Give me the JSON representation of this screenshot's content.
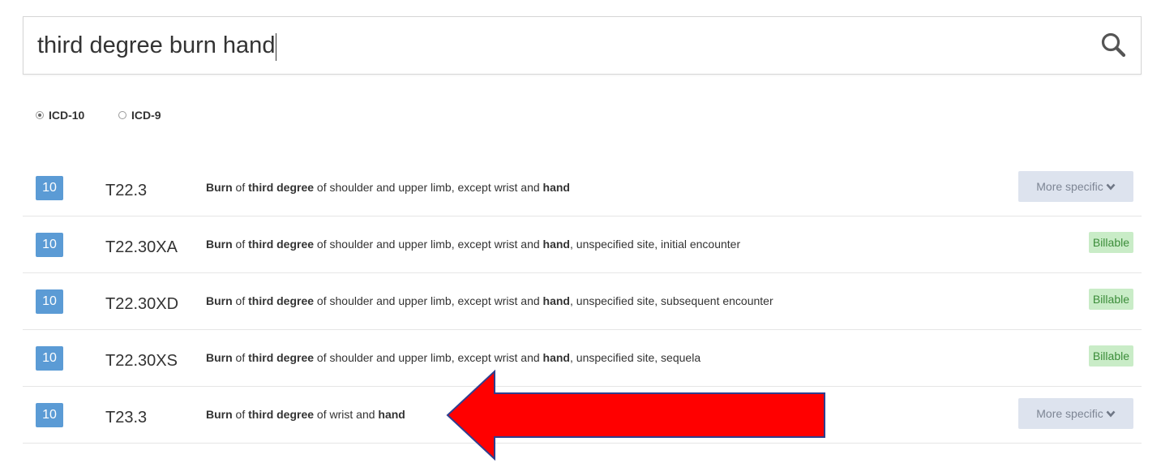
{
  "search": {
    "value": "third degree burn hand",
    "placeholder": "",
    "button_icon": "search-icon"
  },
  "code_system": {
    "selected": "ICD-10",
    "options": [
      {
        "label": "ICD-10",
        "checked": true
      },
      {
        "label": "ICD-9",
        "checked": false
      }
    ]
  },
  "results": [
    {
      "version": "10",
      "code": "T22.3",
      "description": [
        {
          "text": "Burn",
          "bold": true
        },
        {
          "text": " of ",
          "bold": false
        },
        {
          "text": "third degree",
          "bold": true
        },
        {
          "text": " of shoulder and upper limb, except wrist and ",
          "bold": false
        },
        {
          "text": "hand",
          "bold": true
        }
      ],
      "action": {
        "type": "more",
        "label": "More specific",
        "icon": "chevron-down-icon"
      }
    },
    {
      "version": "10",
      "code": "T22.30XA",
      "description": [
        {
          "text": "Burn",
          "bold": true
        },
        {
          "text": " of ",
          "bold": false
        },
        {
          "text": "third degree",
          "bold": true
        },
        {
          "text": " of shoulder and upper limb, except wrist and ",
          "bold": false
        },
        {
          "text": "hand",
          "bold": true
        },
        {
          "text": ", unspecified site, initial encounter",
          "bold": false
        }
      ],
      "action": {
        "type": "billable",
        "label": "Billable"
      }
    },
    {
      "version": "10",
      "code": "T22.30XD",
      "description": [
        {
          "text": "Burn",
          "bold": true
        },
        {
          "text": " of ",
          "bold": false
        },
        {
          "text": "third degree",
          "bold": true
        },
        {
          "text": " of shoulder and upper limb, except wrist and ",
          "bold": false
        },
        {
          "text": "hand",
          "bold": true
        },
        {
          "text": ", unspecified site, subsequent encounter",
          "bold": false
        }
      ],
      "action": {
        "type": "billable",
        "label": "Billable"
      }
    },
    {
      "version": "10",
      "code": "T22.30XS",
      "description": [
        {
          "text": "Burn",
          "bold": true
        },
        {
          "text": " of ",
          "bold": false
        },
        {
          "text": "third degree",
          "bold": true
        },
        {
          "text": " of shoulder and upper limb, except wrist and ",
          "bold": false
        },
        {
          "text": "hand",
          "bold": true
        },
        {
          "text": ", unspecified site, sequela",
          "bold": false
        }
      ],
      "action": {
        "type": "billable",
        "label": "Billable"
      }
    },
    {
      "version": "10",
      "code": "T23.3",
      "description": [
        {
          "text": "Burn",
          "bold": true
        },
        {
          "text": " of ",
          "bold": false
        },
        {
          "text": "third degree",
          "bold": true
        },
        {
          "text": " of wrist and ",
          "bold": false
        },
        {
          "text": "hand",
          "bold": true
        }
      ],
      "action": {
        "type": "more",
        "label": "More specific",
        "icon": "chevron-down-icon"
      }
    }
  ],
  "annotation": {
    "shape": "arrow-left",
    "fill_color": "#ff0000",
    "stroke_color": "#2f3f8f",
    "points_to_code": "T23.3"
  },
  "colors": {
    "version_badge": "#5b9bd5",
    "billable_bg": "#c9ecc7",
    "billable_text": "#3c8d3a",
    "more_btn_bg": "#dde3ee",
    "more_btn_text": "#7d8594"
  }
}
